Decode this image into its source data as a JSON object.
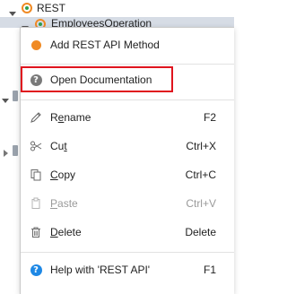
{
  "tree": {
    "root_label": "REST",
    "child_label": "EmployeesOperation"
  },
  "menu": {
    "items": [
      {
        "label": "Add REST API Method",
        "shortcut": "",
        "icon": "orange-dot-icon",
        "disabled": false
      },
      {
        "label": "Open Documentation",
        "shortcut": "",
        "icon": "help-circle-icon",
        "disabled": false
      },
      {
        "label": "Rename",
        "shortcut": "F2",
        "icon": "pencil-icon",
        "disabled": false
      },
      {
        "label": "Cut",
        "shortcut": "Ctrl+X",
        "icon": "scissors-icon",
        "disabled": false
      },
      {
        "label": "Copy",
        "shortcut": "Ctrl+C",
        "icon": "copy-icon",
        "disabled": false
      },
      {
        "label": "Paste",
        "shortcut": "Ctrl+V",
        "icon": "paste-icon",
        "disabled": true
      },
      {
        "label": "Delete",
        "shortcut": "Delete",
        "icon": "trash-icon",
        "disabled": false
      },
      {
        "label": "Help with 'REST API'",
        "shortcut": "F1",
        "icon": "help-blue-icon",
        "disabled": false
      }
    ]
  },
  "colors": {
    "highlight_border": "#e0141e",
    "accent_orange": "#f08a24",
    "help_blue": "#1e88e5",
    "selection_bg": "#d6dce5"
  }
}
